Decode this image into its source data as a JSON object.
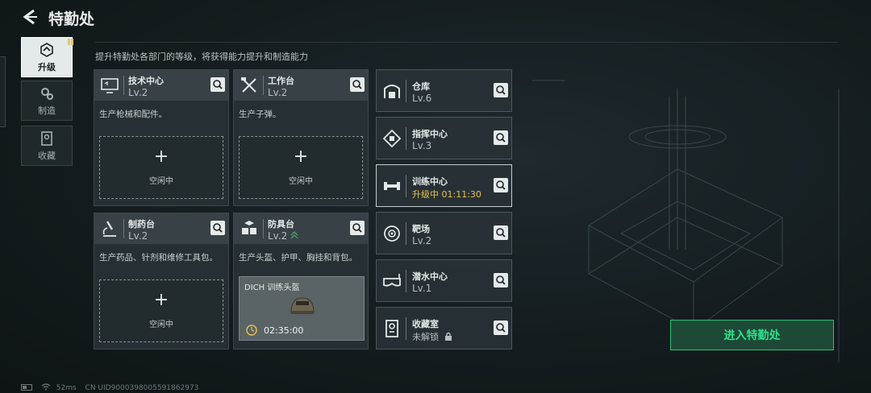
{
  "header": {
    "title": "特勤处"
  },
  "sidebar": {
    "items": [
      {
        "label": "升级",
        "icon": "upgrade-icon",
        "active": true
      },
      {
        "label": "制造",
        "icon": "gears-icon",
        "active": false
      },
      {
        "label": "收藏",
        "icon": "collection-icon",
        "active": false
      }
    ]
  },
  "subtitle": "提升特勤处各部门的等级，将获得能力提升和制造能力",
  "cards": [
    {
      "name": "技术中心",
      "level": "Lv.2",
      "desc": "生产枪械和配件。",
      "slot_label": "空闲中",
      "plus": "+"
    },
    {
      "name": "工作台",
      "level": "Lv.2",
      "desc": "生产子弹。",
      "slot_label": "空闲中",
      "plus": "+"
    },
    {
      "name": "制药台",
      "level": "Lv.2",
      "desc": "生产药品、针剂和维修工具包。",
      "slot_label": "空闲中",
      "plus": "+"
    },
    {
      "name": "防具台",
      "level": "Lv.2",
      "desc": "生产头盔、护甲、胸挂和背包。",
      "craft_item": "DICH 训练头盔",
      "craft_time": "02:35:00"
    }
  ],
  "rows": [
    {
      "name": "仓库",
      "level": "Lv.6"
    },
    {
      "name": "指挥中心",
      "level": "Lv.3"
    },
    {
      "name": "训练中心",
      "level": "升级中 01:11:30"
    },
    {
      "name": "靶场",
      "level": "Lv.2"
    },
    {
      "name": "潜水中心",
      "level": "Lv.1"
    },
    {
      "name": "收藏室",
      "level": "未解锁"
    }
  ],
  "enter_button": "进入特勤处",
  "status_bar": {
    "ping": "52ms",
    "uid": "CN UID9000398005591862973"
  },
  "colors": {
    "accent_green": "#2fe08c",
    "upgrade_yellow": "#e8c24e",
    "flag_yellow": "#e3c86a"
  }
}
